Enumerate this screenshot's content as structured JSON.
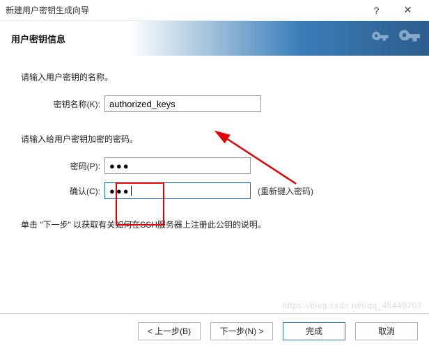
{
  "titlebar": {
    "title": "新建用户密钥生成向导",
    "help": "?",
    "close": "×"
  },
  "header": {
    "title": "用户密钥信息"
  },
  "body": {
    "name_prompt": "请输入用户密钥的名称。",
    "name_label": "密钥名称(K):",
    "name_value": "authorized_keys",
    "pw_prompt": "请输入给用户密钥加密的密码。",
    "pw_label": "密码(P):",
    "pw_value": "●●●",
    "confirm_label": "确认(C):",
    "confirm_value": "●●●",
    "retype_hint": "(重新键入密码)",
    "instruction": "单击 \"下一步\" 以获取有关如何在SSH服务器上注册此公钥的说明。"
  },
  "footer": {
    "back": "< 上一步(B)",
    "next": "下一步(N) >",
    "finish": "完成",
    "cancel": "取消"
  },
  "watermark": "https://blog.csdn.net/qq_45449707"
}
